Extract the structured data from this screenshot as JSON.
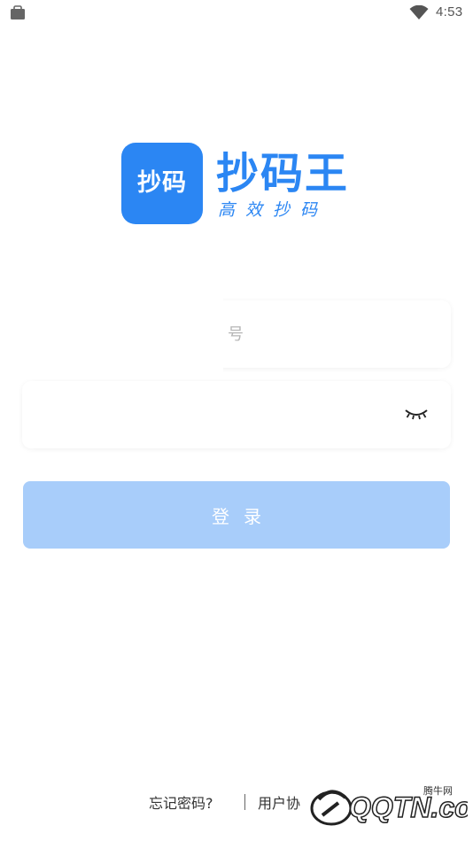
{
  "status_bar": {
    "time": "4:53",
    "icons": [
      "bag-icon",
      "wifi-icon"
    ]
  },
  "logo": {
    "tile_text": "抄码",
    "app_name": "抄码王",
    "slogan": "高效抄码",
    "brand_color": "#2b86f3"
  },
  "form": {
    "account_placeholder": "号",
    "password_placeholder": "",
    "eye_icon": "eye-closed-icon"
  },
  "login": {
    "label": "登录",
    "color": "#a8cdfa"
  },
  "footer": {
    "forgot_password": "忘记密码?",
    "user_agreement": "用户协"
  },
  "watermark": {
    "site_name": "腾牛网",
    "domain": "QQTN.com"
  }
}
